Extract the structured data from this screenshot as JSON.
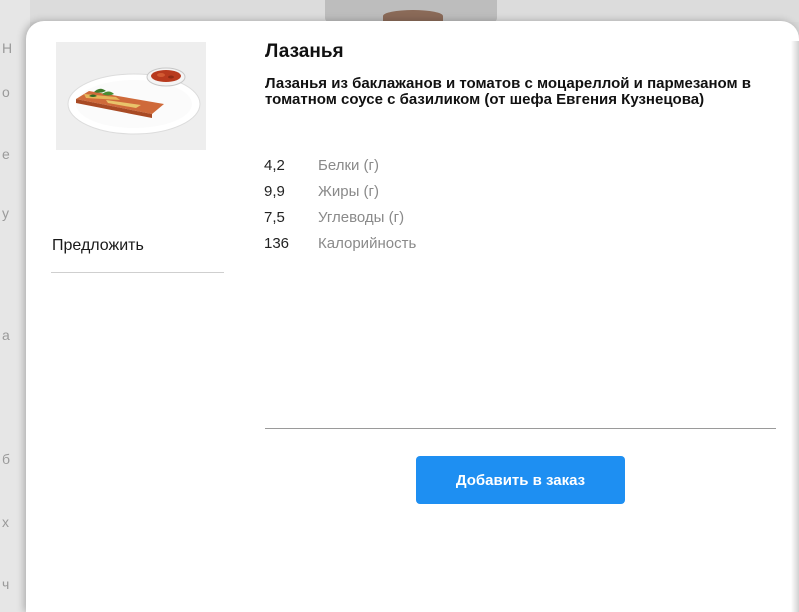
{
  "background": {
    "fragments": [
      "Н",
      "о",
      "е",
      "у",
      "а",
      "б",
      "х",
      "ч"
    ]
  },
  "dish": {
    "title": "Лазанья",
    "description": "Лазанья из баклажанов и томатов с моцареллой и пармезаном в томатном соусе с базиликом (от шефа Евгения Кузнецова)",
    "photo_icon": "dish-photo"
  },
  "nutrition": [
    {
      "value": "4,2",
      "label": "Белки (г)"
    },
    {
      "value": "9,9",
      "label": "Жиры (г)"
    },
    {
      "value": "7,5",
      "label": "Углеводы (г)"
    },
    {
      "value": "136",
      "label": "Калорийность"
    }
  ],
  "actions": {
    "suggest_label": "Предложить",
    "add_to_order_label": "Добавить в заказ"
  },
  "colors": {
    "accent": "#1e8ff2",
    "muted_text": "#8a8a8a"
  }
}
